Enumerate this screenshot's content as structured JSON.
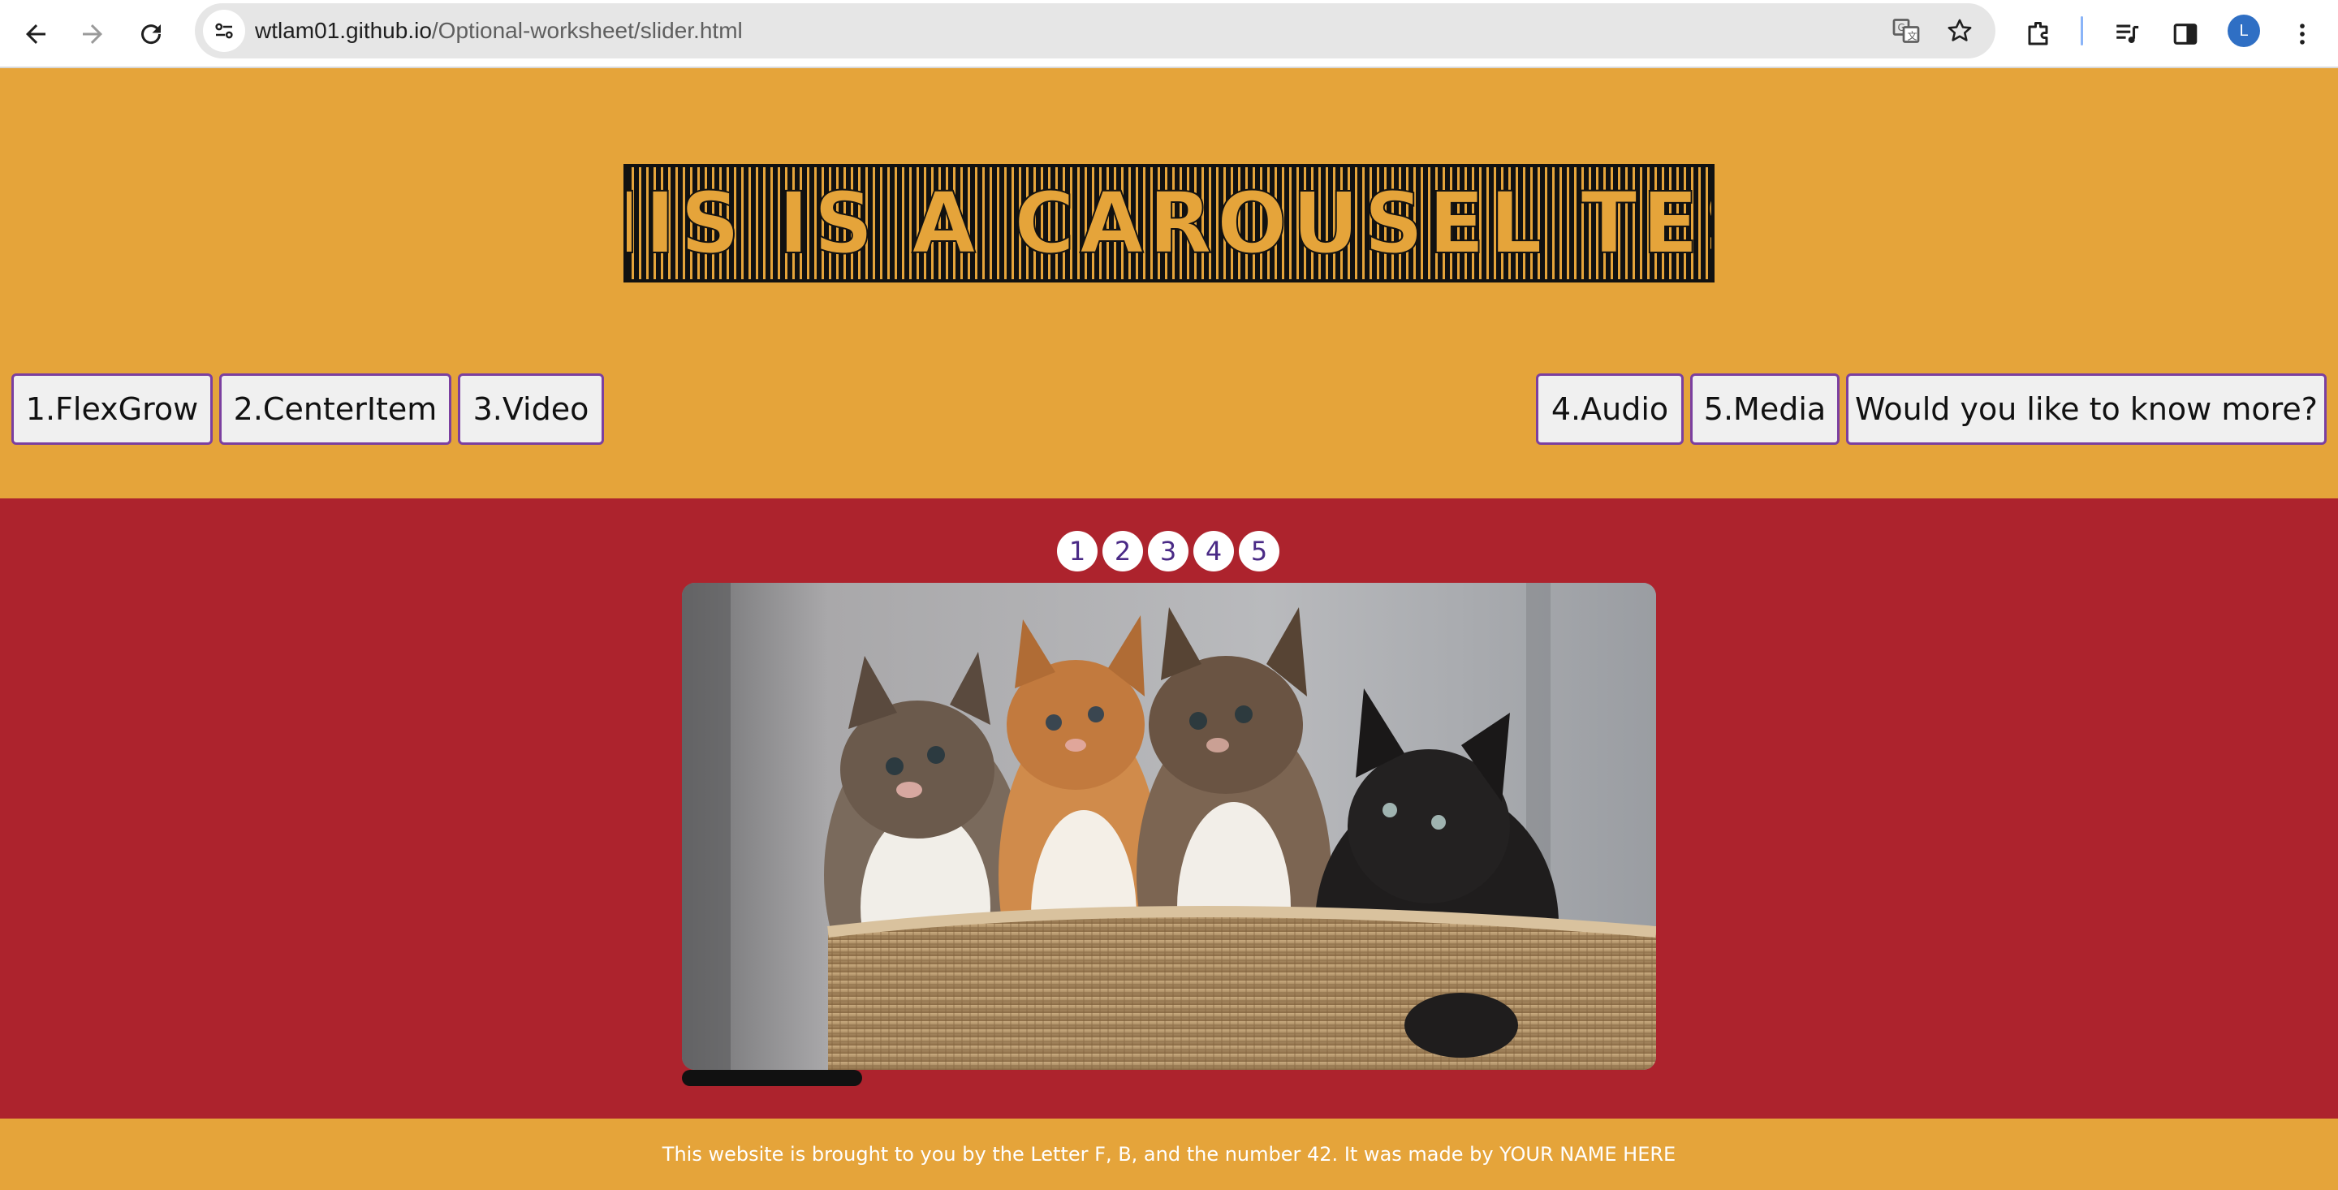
{
  "browser": {
    "url_host": "wtlam01.github.io",
    "url_path": "/Optional-worksheet/slider.html",
    "avatar_letter": "L",
    "icons": [
      "back-arrow-icon",
      "forward-arrow-icon",
      "reload-icon",
      "site-info-icon",
      "translate-icon",
      "bookmark-star-icon",
      "extensions-icon",
      "media-controls-icon",
      "side-panel-icon",
      "profile-avatar",
      "kebab-menu-icon"
    ]
  },
  "header": {
    "title": "THIS IS A CAROUSEL TEST",
    "nav_left": [
      "1.FlexGrow",
      "2.CenterItem",
      "3.Video"
    ],
    "nav_right": [
      "4.Audio",
      "5.Media",
      "Would you like to know more?"
    ]
  },
  "carousel": {
    "slide_links": [
      "1",
      "2",
      "3",
      "4",
      "5"
    ],
    "current_slide": 1,
    "slide_count": 5,
    "image_subject": "four kittens in a woven basket",
    "scroll_progress": 0.185
  },
  "footer": {
    "text": "This website is brought to you by the Letter F, B, and the number 42. It was made by YOUR NAME HERE"
  },
  "colors": {
    "header_bg": "#e5a43a",
    "carousel_bg": "#ad232d",
    "button_border": "#7b3fa0",
    "dot_text": "#4a2a86"
  }
}
